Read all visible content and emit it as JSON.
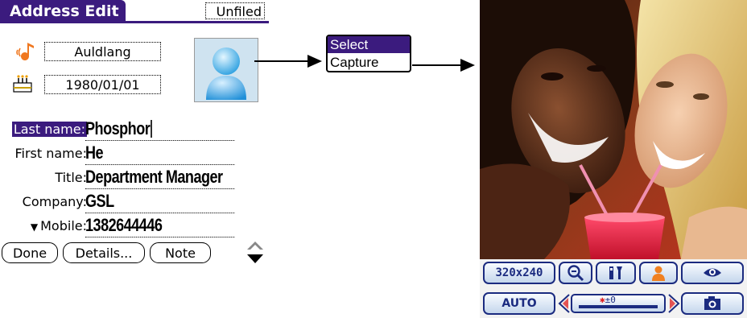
{
  "address_edit": {
    "title": "Address Edit",
    "category": "Unfiled",
    "ringtone": "Auldlang",
    "birthday": "1980/01/01",
    "fields": [
      {
        "label": "Last name:",
        "value": "Phosphor"
      },
      {
        "label": "First name:",
        "value": "He"
      },
      {
        "label": "Title:",
        "value": "Department Manager"
      },
      {
        "label": "Company:",
        "value": "GSL"
      },
      {
        "label": "Mobile:",
        "value": "1382644446"
      }
    ],
    "buttons": {
      "done": "Done",
      "details": "Details...",
      "note": "Note"
    }
  },
  "popup_menu": {
    "items": [
      "Select",
      "Capture"
    ],
    "selected": "Select"
  },
  "camera": {
    "resolution": "320x240",
    "mode": "AUTO",
    "exposure": "±0"
  },
  "icons": {
    "ringtone": "music-note-icon",
    "birthday": "birthday-cake-icon",
    "photo": "person-placeholder-icon",
    "scroll": "scroll-arrows-icon",
    "zoom": "magnifier-icon",
    "tools": "tools-icon",
    "person": "person-icon",
    "eye": "eye-icon",
    "shutter": "camera-icon"
  },
  "colors": {
    "palm_accent": "#3b1b7e",
    "camera_button_border": "#1b2b80"
  }
}
